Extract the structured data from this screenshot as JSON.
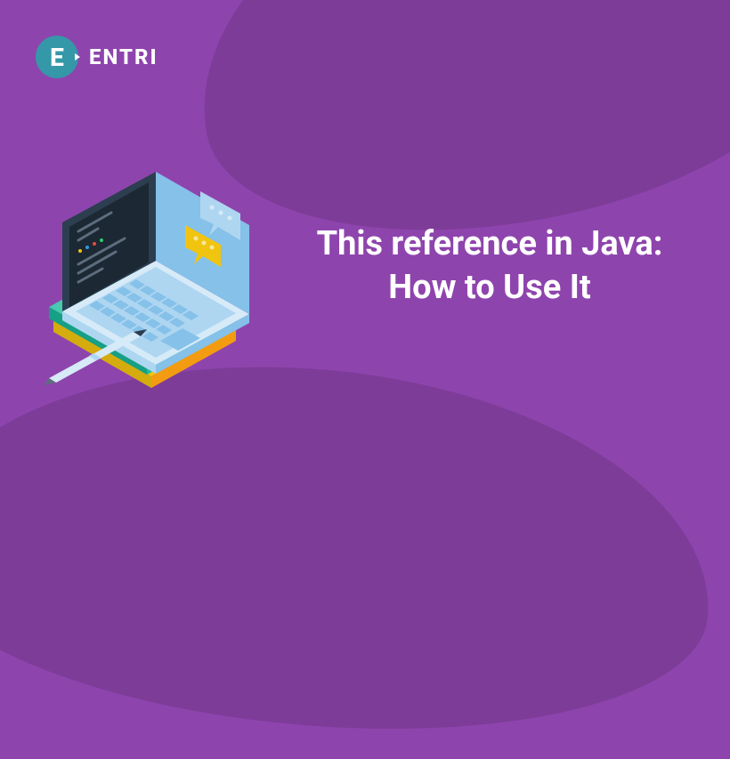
{
  "logo": {
    "letter": "E",
    "brand": "ENTRI"
  },
  "title": {
    "line1": "This reference in Java:",
    "line2": "How to Use It"
  },
  "colors": {
    "background": "#8e44ad",
    "background_shape": "#7d3c98",
    "logo_circle": "#3498a8",
    "accent_yellow": "#f1c40f",
    "laptop_light": "#aed6f1",
    "laptop_dark": "#2c3e50"
  }
}
